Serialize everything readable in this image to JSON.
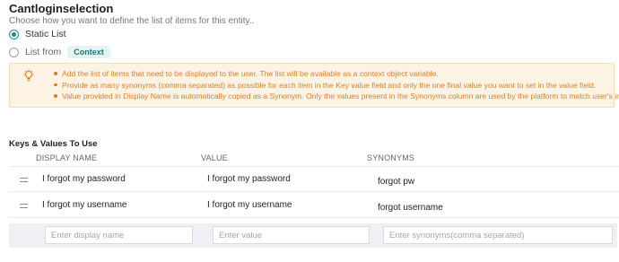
{
  "header": {
    "title": "Cantloginselection",
    "subtitle": "Choose how you want to define the list of items for this entity.."
  },
  "options": {
    "static_label": "Static List",
    "list_from_label": "List from",
    "context_badge": "Context",
    "selected": "Static List"
  },
  "info": {
    "icon": "lightbulb-icon",
    "items": [
      "Add the list of items that need to be displayed to the user. The list will be available as a context object variable.",
      "Provide as many synonyms (comma separated) as possible for each item in the Key value field and only the one final value you want to set in the value field.",
      "Value provided in Display Name is automatically copied as a Synonym. Only the values present in the Synonyms column are used by the platform to match user's input."
    ]
  },
  "table": {
    "section_title": "Keys & Values To Use",
    "columns": [
      "DISPLAY NAME",
      "VALUE",
      "SYNONYMS"
    ],
    "rows": [
      {
        "display": "I forgot my password",
        "value": "I forgot my password",
        "synonyms": "forgot pw"
      },
      {
        "display": "I forgot my username",
        "value": "I forgot my username",
        "synonyms": "forgot username"
      }
    ],
    "new_row": {
      "display_placeholder": "Enter display name",
      "value_placeholder": "Enter value",
      "synonyms_placeholder": "Enter synonyms(comma separated)"
    }
  },
  "colors": {
    "accent": "#1a8c8c",
    "info_bg": "#fcf3e4",
    "info_text": "#d9822b"
  }
}
